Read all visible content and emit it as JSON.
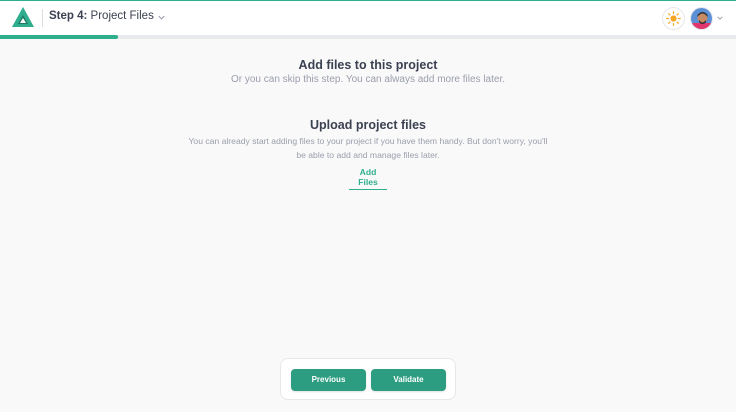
{
  "header": {
    "step_prefix": "Step 4:",
    "step_name": "Project Files",
    "progress_fraction": 0.16
  },
  "intro": {
    "title": "Add files to this project",
    "subtitle": "Or you can skip this step. You can always add more files later."
  },
  "upload": {
    "title": "Upload project files",
    "description": "You can already start adding files to your project if you have them handy. But don't worry, you'll be able to add and manage files later.",
    "add_files_label": "Add Files"
  },
  "footer": {
    "previous_label": "Previous",
    "validate_label": "Validate"
  },
  "colors": {
    "accent": "#2fae8d",
    "button": "#2c9d80",
    "sun": "#f5a623"
  },
  "icons": [
    "logo-icon",
    "chevron-down-icon",
    "sun-icon",
    "avatar"
  ]
}
